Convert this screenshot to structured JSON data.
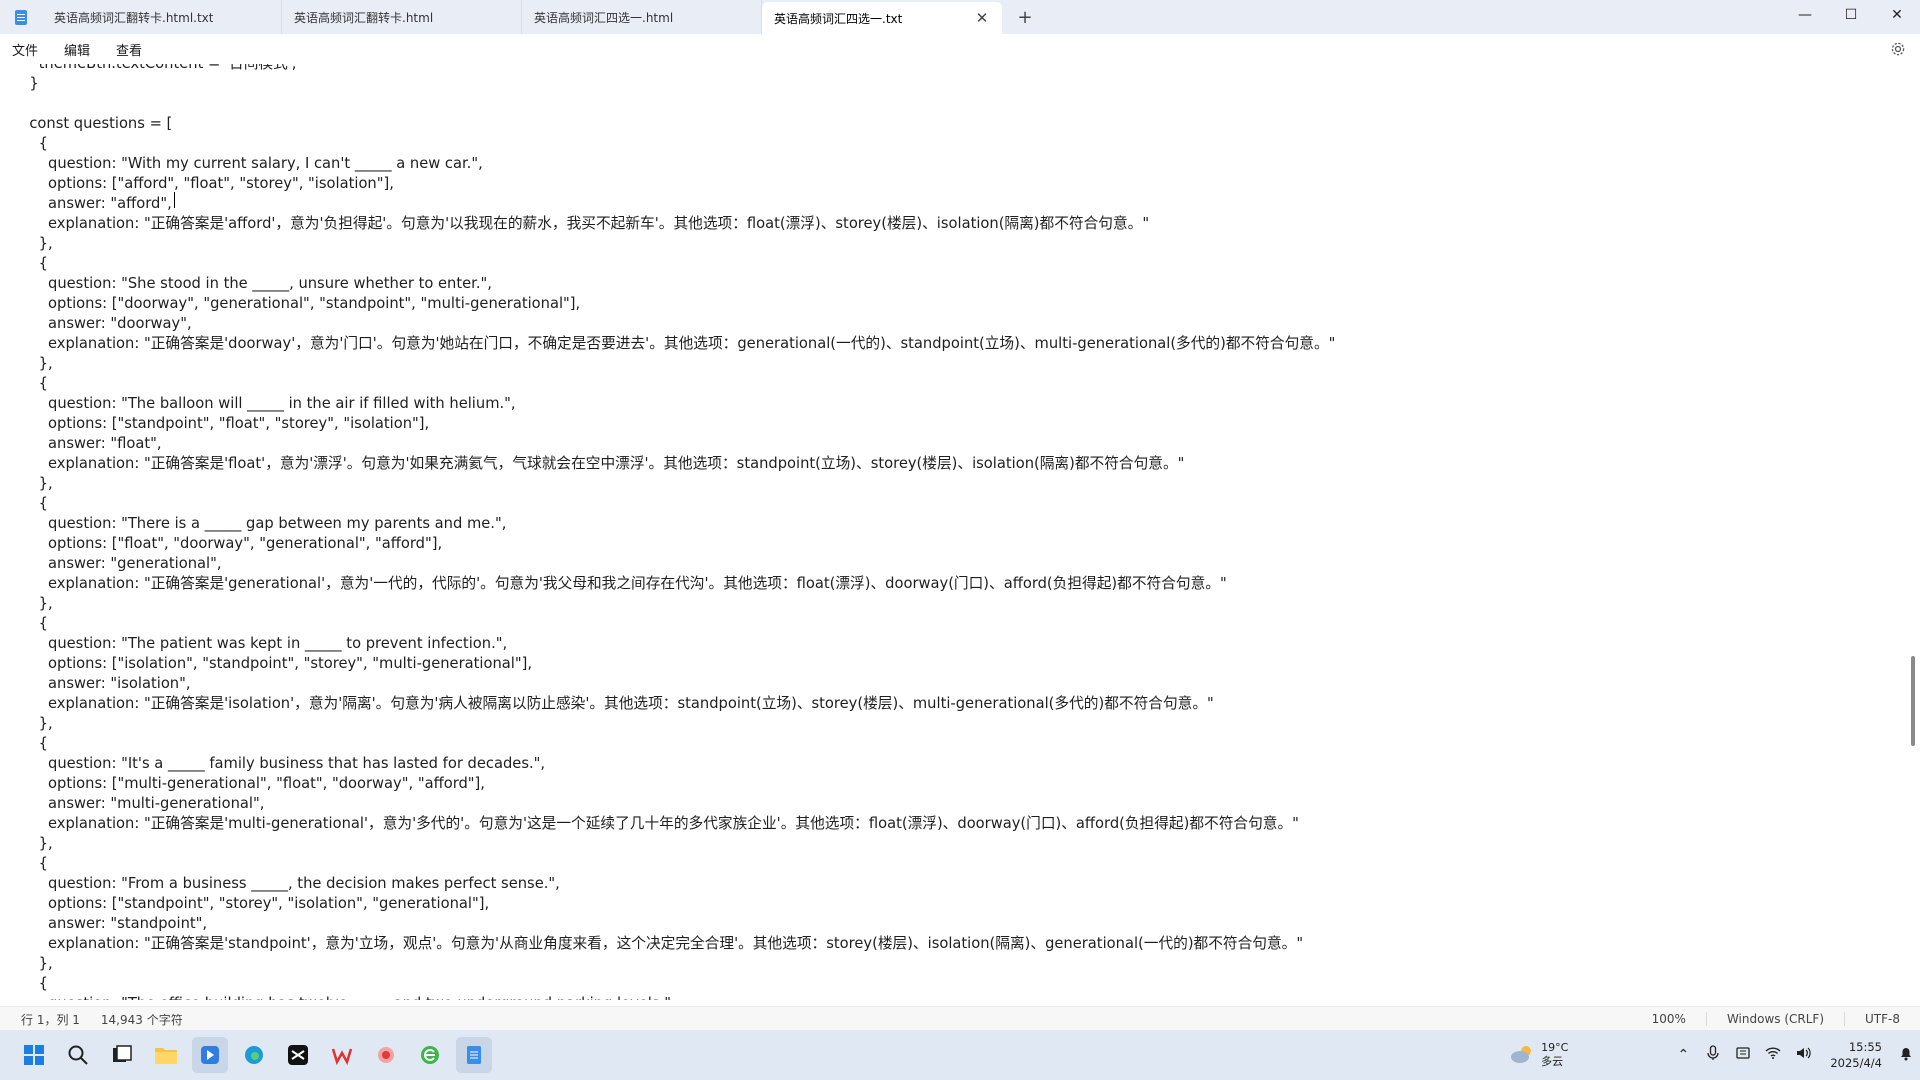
{
  "window": {
    "tabs": [
      {
        "label": "英语高频词汇翻转卡.html.txt",
        "active": false
      },
      {
        "label": "英语高频词汇翻转卡.html",
        "active": false
      },
      {
        "label": "英语高频词汇四选一.html",
        "active": false
      },
      {
        "label": "英语高频词汇四选一.txt",
        "active": true
      }
    ],
    "new_tab": "+",
    "controls": {
      "minimize": "—",
      "maximize": "☐",
      "close": "✕"
    }
  },
  "menu": {
    "items": [
      "文件",
      "编辑",
      "查看"
    ]
  },
  "editor": {
    "lines": [
      "    themeBtn.textContent = '日间模式';",
      "  }",
      "",
      "  const questions = [",
      "    {",
      "      question: \"With my current salary, I can't _____ a new car.\",",
      "      options: [\"afford\", \"float\", \"storey\", \"isolation\"],",
      "      answer: \"afford\",",
      "      explanation: \"正确答案是'afford'，意为'负担得起'。句意为'以我现在的薪水，我买不起新车'。其他选项：float(漂浮)、storey(楼层)、isolation(隔离)都不符合句意。\"",
      "    },",
      "    {",
      "      question: \"She stood in the _____, unsure whether to enter.\",",
      "      options: [\"doorway\", \"generational\", \"standpoint\", \"multi-generational\"],",
      "      answer: \"doorway\",",
      "      explanation: \"正确答案是'doorway'，意为'门口'。句意为'她站在门口，不确定是否要进去'。其他选项：generational(一代的)、standpoint(立场)、multi-generational(多代的)都不符合句意。\"",
      "    },",
      "    {",
      "      question: \"The balloon will _____ in the air if filled with helium.\",",
      "      options: [\"standpoint\", \"float\", \"storey\", \"isolation\"],",
      "      answer: \"float\",",
      "      explanation: \"正确答案是'float'，意为'漂浮'。句意为'如果充满氦气，气球就会在空中漂浮'。其他选项：standpoint(立场)、storey(楼层)、isolation(隔离)都不符合句意。\"",
      "    },",
      "    {",
      "      question: \"There is a _____ gap between my parents and me.\",",
      "      options: [\"float\", \"doorway\", \"generational\", \"afford\"],",
      "      answer: \"generational\",",
      "      explanation: \"正确答案是'generational'，意为'一代的，代际的'。句意为'我父母和我之间存在代沟'。其他选项：float(漂浮)、doorway(门口)、afford(负担得起)都不符合句意。\"",
      "    },",
      "    {",
      "      question: \"The patient was kept in _____ to prevent infection.\",",
      "      options: [\"isolation\", \"standpoint\", \"storey\", \"multi-generational\"],",
      "      answer: \"isolation\",",
      "      explanation: \"正确答案是'isolation'，意为'隔离'。句意为'病人被隔离以防止感染'。其他选项：standpoint(立场)、storey(楼层)、multi-generational(多代的)都不符合句意。\"",
      "    },",
      "    {",
      "      question: \"It's a _____ family business that has lasted for decades.\",",
      "      options: [\"multi-generational\", \"float\", \"doorway\", \"afford\"],",
      "      answer: \"multi-generational\",",
      "      explanation: \"正确答案是'multi-generational'，意为'多代的'。句意为'这是一个延续了几十年的多代家族企业'。其他选项：float(漂浮)、doorway(门口)、afford(负担得起)都不符合句意。\"",
      "    },",
      "    {",
      "      question: \"From a business _____, the decision makes perfect sense.\",",
      "      options: [\"standpoint\", \"storey\", \"isolation\", \"generational\"],",
      "      answer: \"standpoint\",",
      "      explanation: \"正确答案是'standpoint'，意为'立场，观点'。句意为'从商业角度来看，这个决定完全合理'。其他选项：storey(楼层)、isolation(隔离)、generational(一代的)都不符合句意。\"",
      "    },",
      "    {",
      "      question: \"The office building has twelve _____ and two underground parking levels.\","
    ]
  },
  "status": {
    "position": "行 1，列 1",
    "char_count": "14,943 个字符",
    "zoom": "100%",
    "line_ending": "Windows (CRLF)",
    "encoding": "UTF-8"
  },
  "taskbar": {
    "weather_temp": "19°C",
    "weather_desc": "多云",
    "time": "15:55",
    "date": "2025/4/4"
  },
  "colors": {
    "tab_bar": "#e9eef6",
    "taskbar": "#dfe8f3",
    "accent": "#3b8ee8"
  }
}
